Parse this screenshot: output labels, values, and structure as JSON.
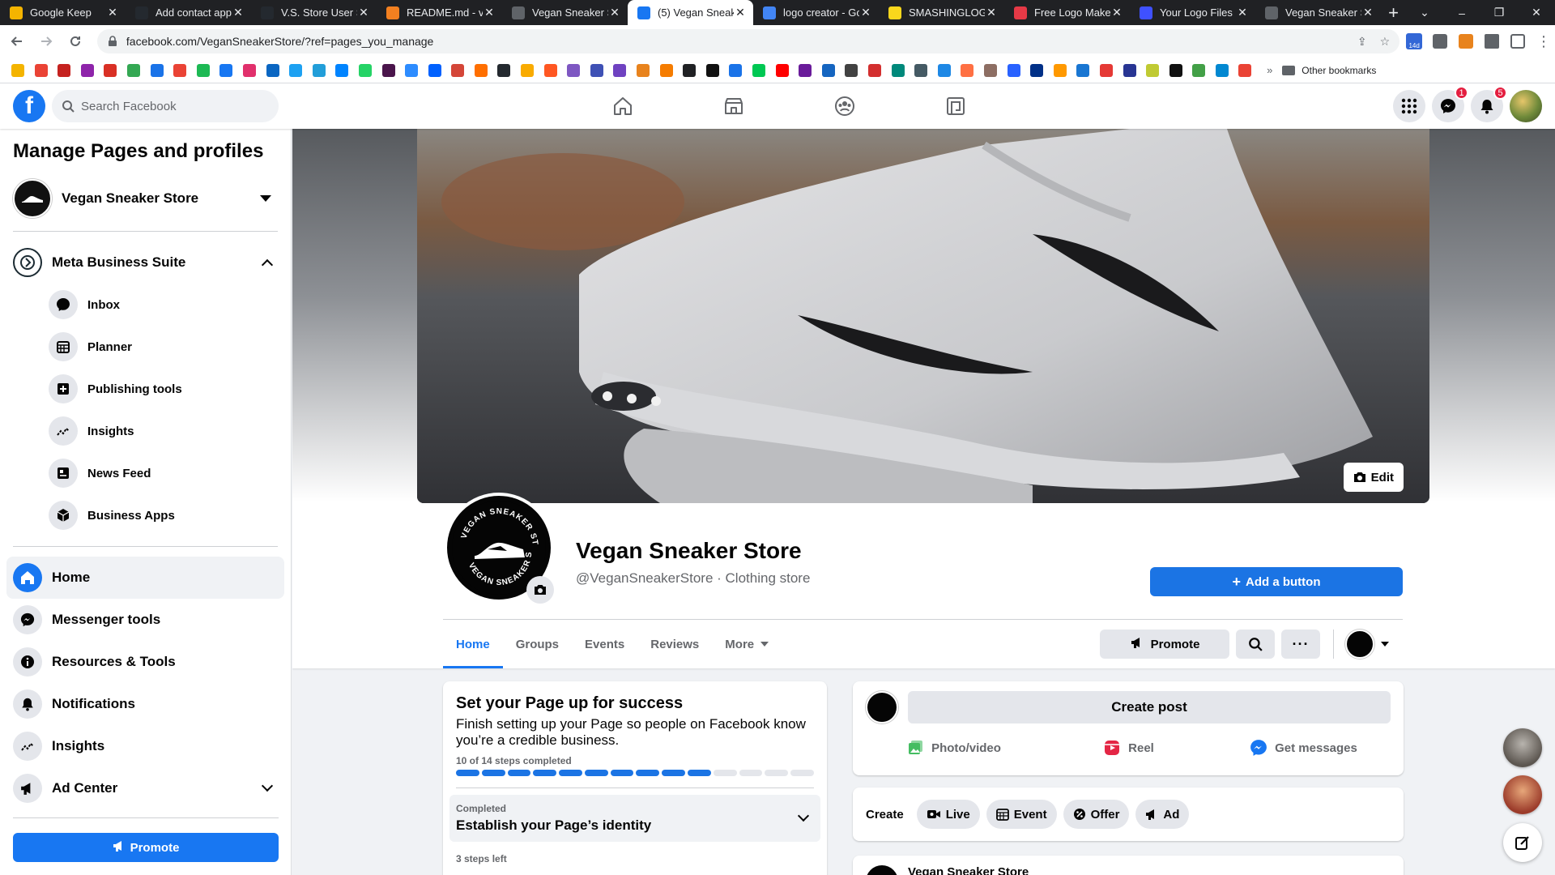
{
  "browser": {
    "tabs": [
      {
        "title": "Google Keep",
        "color": "#f4b400",
        "icon": "keep-icon"
      },
      {
        "title": "Add contact app",
        "color": "#24292f",
        "icon": "github-icon"
      },
      {
        "title": "V.S. Store User S",
        "color": "#24292f",
        "icon": "github-icon"
      },
      {
        "title": "README.md - ve",
        "color": "#f38020",
        "icon": "gitpod-icon"
      },
      {
        "title": "Vegan Sneaker S",
        "color": "#5f6368",
        "icon": "globe-icon"
      },
      {
        "title": "(5) Vegan Sneak",
        "color": "#1877f2",
        "icon": "facebook-icon",
        "active": true
      },
      {
        "title": "logo creator - Go",
        "color": "#4285f4",
        "icon": "google-icon"
      },
      {
        "title": "SMASHINGLOGO",
        "color": "#f9d71c",
        "icon": "smashinglogo-icon"
      },
      {
        "title": "Free Logo Maker",
        "color": "#e63946",
        "icon": "logomaker-icon"
      },
      {
        "title": "Your Logo Files |",
        "color": "#3f51ff",
        "icon": "looka-icon"
      },
      {
        "title": "Vegan Sneaker S",
        "color": "#5f6368",
        "icon": "globe-icon"
      }
    ],
    "url": "facebook.com/VeganSneakerStore/?ref=pages_you_manage",
    "other_bookmarks": "Other bookmarks",
    "ext_badge": "14d"
  },
  "fb": {
    "search_placeholder": "Search Facebook",
    "messenger_badge": "1",
    "notifications_badge": "5"
  },
  "sidebar": {
    "title": "Manage Pages and profiles",
    "page_name": "Vegan Sneaker Store",
    "mbs_label": "Meta Business Suite",
    "mbs_items": [
      {
        "label": "Inbox",
        "icon": "inbox-icon"
      },
      {
        "label": "Planner",
        "icon": "planner-icon"
      },
      {
        "label": "Publishing tools",
        "icon": "publishing-tools-icon"
      },
      {
        "label": "Insights",
        "icon": "insights-icon"
      },
      {
        "label": "News Feed",
        "icon": "news-feed-icon"
      },
      {
        "label": "Business Apps",
        "icon": "business-apps-icon"
      }
    ],
    "items": [
      {
        "label": "Home",
        "icon": "home-icon",
        "active": true
      },
      {
        "label": "Messenger tools",
        "icon": "messenger-icon"
      },
      {
        "label": "Resources & Tools",
        "icon": "info-icon"
      },
      {
        "label": "Notifications",
        "icon": "bell-icon"
      },
      {
        "label": "Insights",
        "icon": "insights-icon"
      },
      {
        "label": "Ad Center",
        "icon": "megaphone-icon"
      }
    ],
    "promote_label": "Promote"
  },
  "page": {
    "cover_edit_label": "Edit",
    "name": "Vegan Sneaker Store",
    "handle_line": "@VeganSneakerStore · Clothing store",
    "add_button_label": "Add a button",
    "tabs": [
      {
        "label": "Home",
        "active": true
      },
      {
        "label": "Groups"
      },
      {
        "label": "Events"
      },
      {
        "label": "Reviews"
      },
      {
        "label": "More",
        "dropdown": true
      }
    ],
    "promote_label": "Promote"
  },
  "setup": {
    "title": "Set your Page up for success",
    "description": "Finish setting up your Page so people on Facebook know you’re a credible business.",
    "steps_text": "10 of 14 steps completed",
    "steps_done": 10,
    "steps_total": 14,
    "row_status": "Completed",
    "row_title": "Establish your Page’s identity",
    "left_text": "3 steps left"
  },
  "composer": {
    "create_post": "Create post",
    "actions": [
      {
        "label": "Photo/video",
        "icon": "photo-video-icon",
        "color": "#45bd62"
      },
      {
        "label": "Reel",
        "icon": "reel-icon",
        "color": "#e42645"
      },
      {
        "label": "Get messages",
        "icon": "messenger-icon",
        "color": "#1877f2"
      }
    ]
  },
  "create": {
    "label": "Create",
    "chips": [
      {
        "label": "Live",
        "icon": "live-icon"
      },
      {
        "label": "Event",
        "icon": "event-icon"
      },
      {
        "label": "Offer",
        "icon": "offer-icon"
      },
      {
        "label": "Ad",
        "icon": "megaphone-icon"
      }
    ]
  },
  "feed": {
    "author": "Vegan Sneaker Store"
  },
  "colors": {
    "fb_blue": "#1877f2",
    "chrome_dark": "#202124",
    "page_bg": "#f0f2f5"
  }
}
